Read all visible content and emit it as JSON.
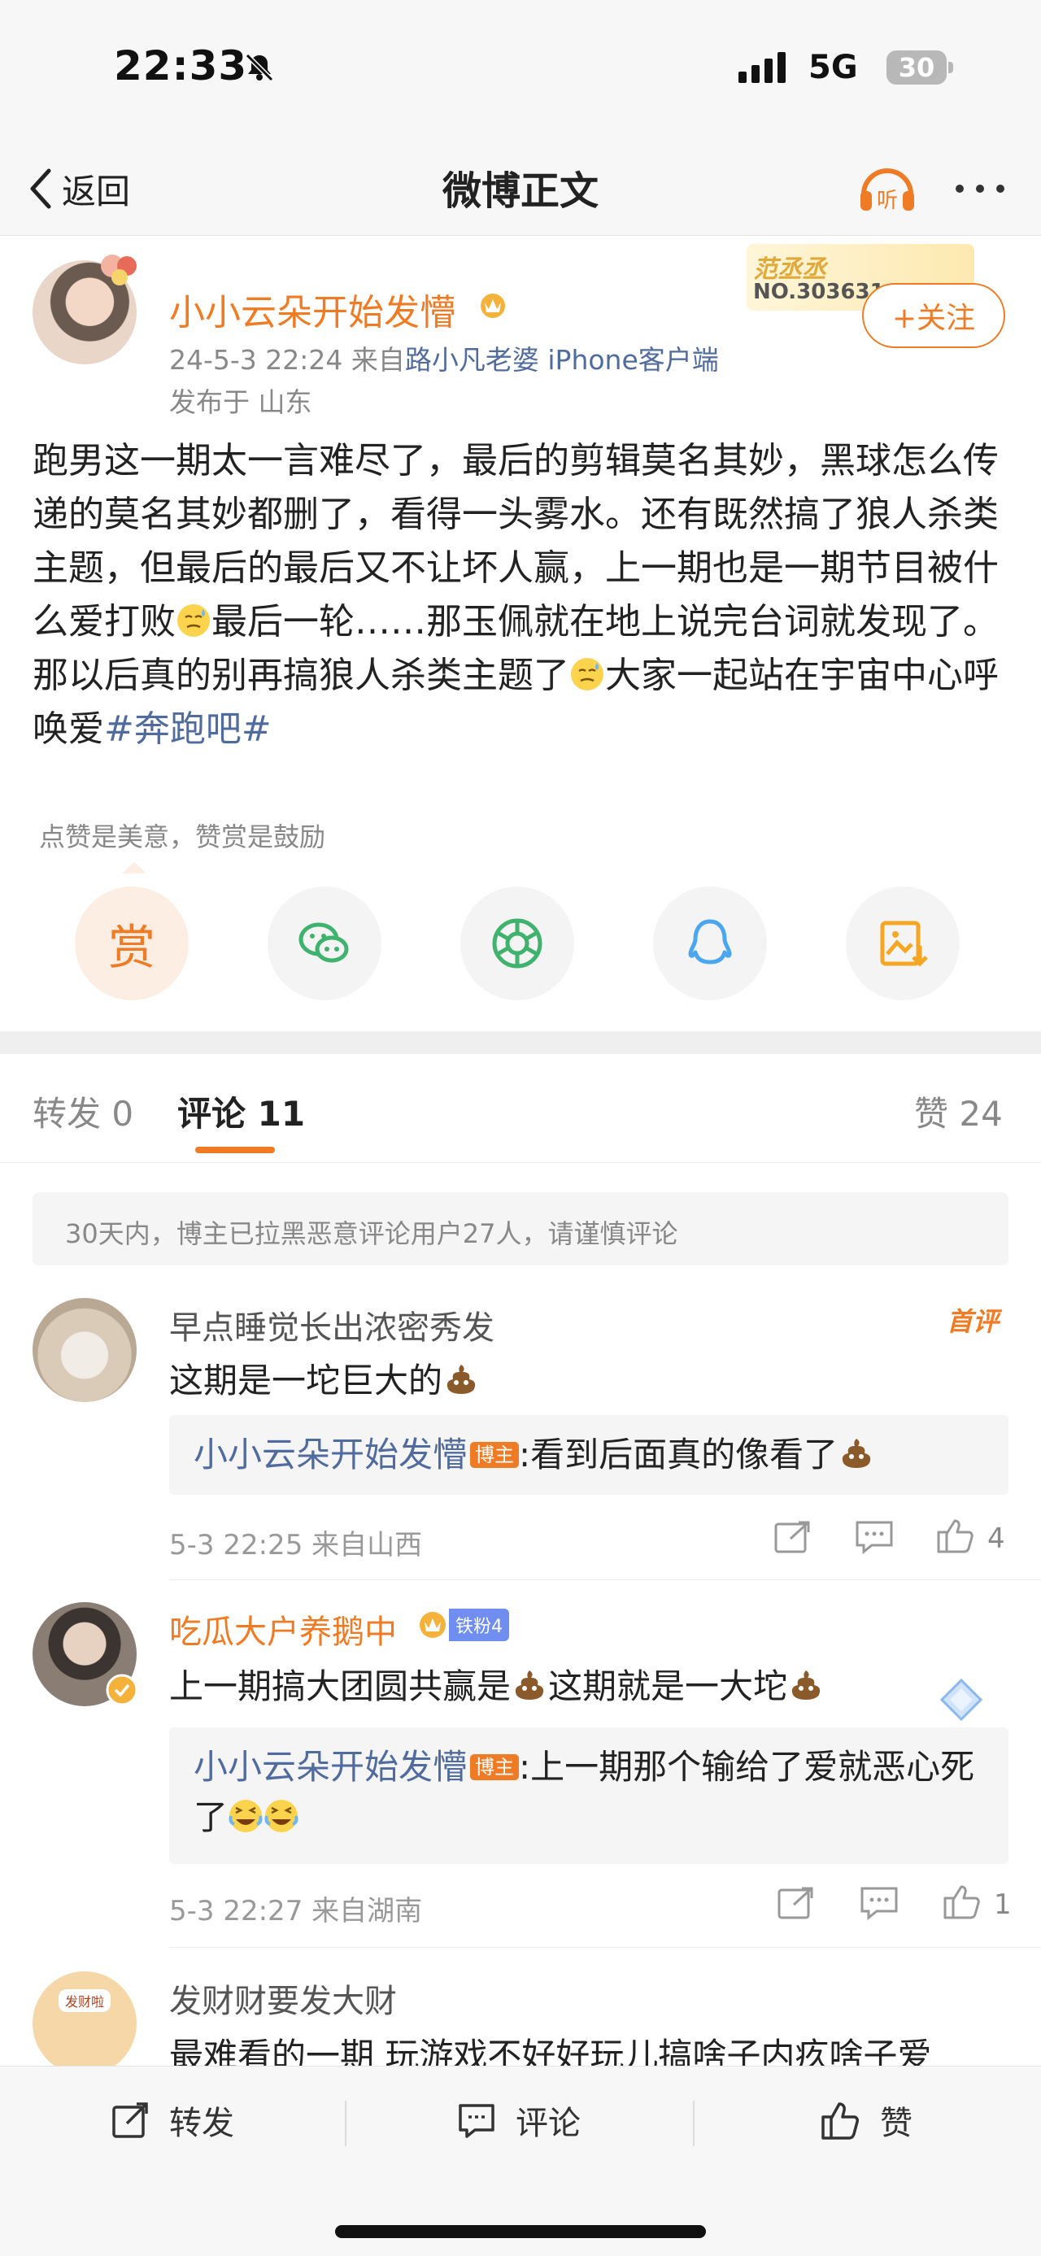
{
  "status_bar": {
    "time": "22:33",
    "network": "5G",
    "battery": "30"
  },
  "nav": {
    "back_label": "返回",
    "title": "微博正文",
    "listen_label": "听"
  },
  "post": {
    "author": "小小云朵开始发懵",
    "meta_prefix": "24-5-3 22:24  来自",
    "meta_source": "路小凡老婆 iPhone客户端",
    "location": "发布于 山东",
    "fan_card_name": "范丞丞",
    "fan_card_no": "NO.303631",
    "follow_label": "+关注",
    "body_part1": "跑男这一期太一言难尽了，最后的剪辑莫名其妙，黑球怎么传递的莫名其妙都删了，看得一头雾水。还有既然搞了狼人杀类主题，但最后的最后又不让坏人赢，上一期也是一期节目被什么爱打败",
    "body_part2": "最后一轮……那玉佩就在地上说完台词就发现了。那以后真的别再搞狼人杀类主题了",
    "body_part3": "大家一起站在宇宙中心呼唤爱",
    "hashtag": "#奔跑吧#",
    "reward_hint": "点赞是美意，赞赏是鼓励",
    "reward_label": "赏"
  },
  "tabs": {
    "repost": "转发 0",
    "comment": "评论 11",
    "like": "赞 24"
  },
  "notice": "30天内，博主已拉黑恶意评论用户27人，请谨慎评论",
  "comments": [
    {
      "name": "早点睡觉长出浓密秀发",
      "badge": "首评",
      "text": "这期是一坨巨大的",
      "reply_name": "小小云朵开始发懵",
      "reply_tag": "博主",
      "reply_text": ":看到后面真的像看了",
      "meta": "5-3 22:25  来自山西",
      "likes": "4"
    },
    {
      "name": "吃瓜大户养鹅中",
      "fan_badge": "铁粉4",
      "text_part1": "上一期搞大团圆共赢是",
      "text_part2": "这期就是一大坨",
      "reply_name": "小小云朵开始发懵",
      "reply_tag": "博主",
      "reply_text": ":上一期那个输给了爱就恶心死了",
      "meta": "5-3 22:27  来自湖南",
      "likes": "1"
    },
    {
      "name": "发财财要发大财",
      "avatar_text": "发财啦",
      "text": "最难看的一期 玩游戏不好好玩儿搞啥子内疚啥子爱"
    }
  ],
  "bottom_bar": {
    "repost": "转发",
    "comment": "评论",
    "like": "赞"
  },
  "colors": {
    "accent": "#f07b25",
    "link": "#506b9d"
  }
}
